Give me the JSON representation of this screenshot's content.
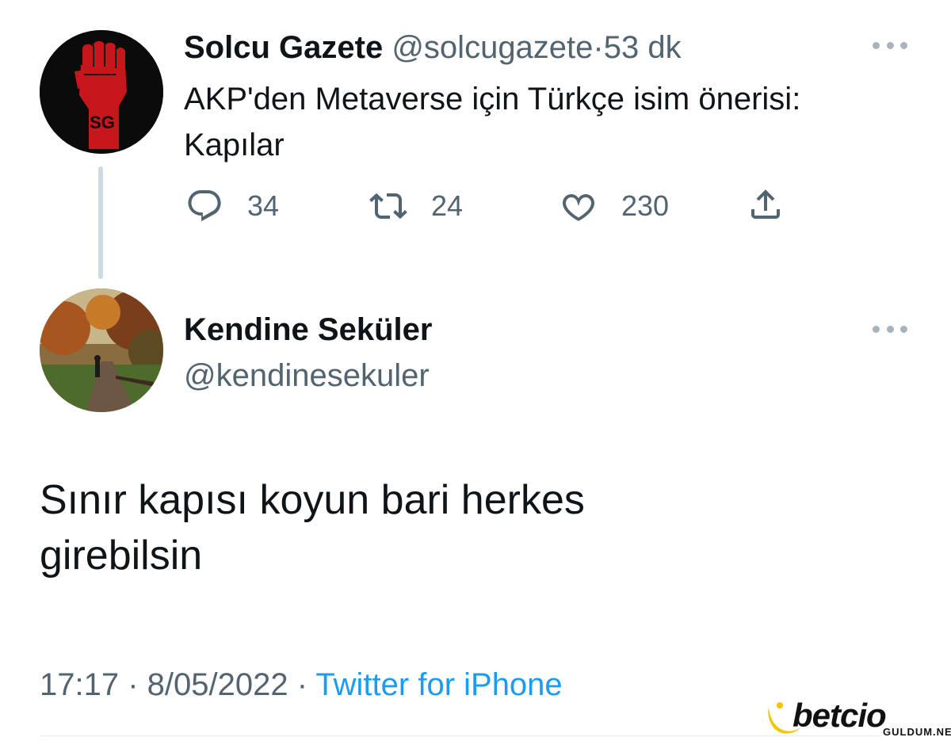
{
  "parent_tweet": {
    "author_name": "Solcu Gazete",
    "handle": "@solcugazete",
    "separator": "·",
    "time": "53 dk",
    "text_line1": "AKP'den Metaverse için Türkçe isim önerisi:",
    "text_line2": "Kapılar",
    "avatar_logo_text": "SG",
    "actions": {
      "reply_count": "34",
      "retweet_count": "24",
      "like_count": "230"
    }
  },
  "reply_tweet": {
    "author_name": "Kendine Seküler",
    "handle": "@kendinesekuler",
    "text_line1": "Sınır kapısı koyun bari herkes",
    "text_line2": "girebilsin",
    "timestamp": "17:17 · 8/05/2022 ·",
    "source": "Twitter for iPhone"
  },
  "watermark": {
    "brand": "betcio",
    "site": "GULDUM.NET"
  },
  "colors": {
    "text": "#0f1419",
    "muted": "#536471",
    "link": "#1d9bf0",
    "thread_line": "#cfd9de",
    "logo_red": "#c8161d",
    "watermark_yellow": "#f5c400"
  }
}
